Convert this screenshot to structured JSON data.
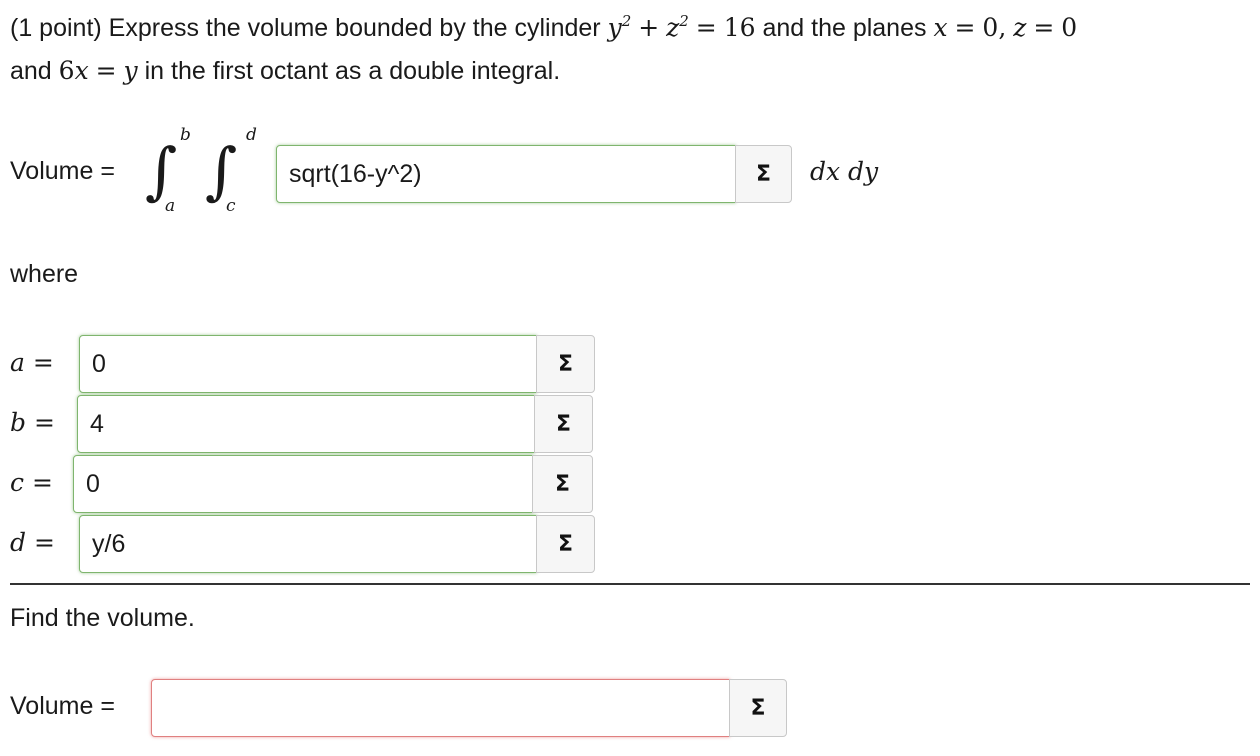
{
  "problem": {
    "points": "(1 point)",
    "text_1": "Express the volume bounded by the cylinder",
    "y": "y",
    "z": "z",
    "x": "x",
    "sq": "2",
    "plus": "+",
    "eq": "=",
    "sixteen": "16",
    "text_2": "and the planes",
    "zero": "0",
    "comma": ",",
    "and": "and",
    "six": "6",
    "text_3": "in the first octant as a double integral."
  },
  "volume_row": {
    "label": "Volume =",
    "upper_outer": "b",
    "lower_outer": "a",
    "upper_inner": "d",
    "lower_inner": "c",
    "integrand_value": "sqrt(16-y^2)",
    "differentials": "dx dy"
  },
  "where_label": "where",
  "limits": [
    {
      "var": "a",
      "eq": "=",
      "value": "0"
    },
    {
      "var": "b",
      "eq": "=",
      "value": "4"
    },
    {
      "var": "c",
      "eq": "=",
      "value": "0"
    },
    {
      "var": "d",
      "eq": "=",
      "value": "y/6"
    }
  ],
  "find_volume": {
    "text": "Find the volume.",
    "label": "Volume =",
    "value": ""
  },
  "sigma_symbol": "Σ",
  "icons": {
    "equation_editor": "sigma-icon"
  },
  "colors": {
    "correct_border": "#7fb56e",
    "incorrect_border": "#e08080"
  }
}
